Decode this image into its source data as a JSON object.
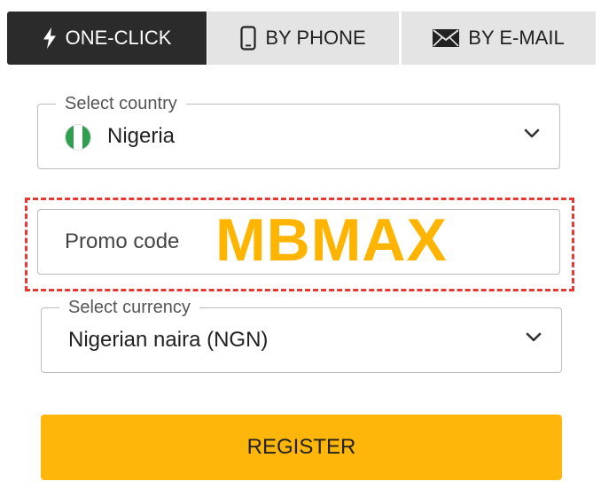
{
  "tabs": [
    {
      "label": "ONE-CLICK",
      "icon": "lightning-icon",
      "active": true
    },
    {
      "label": "BY PHONE",
      "icon": "phone-icon",
      "active": false
    },
    {
      "label": "BY E-MAIL",
      "icon": "envelope-icon",
      "active": false
    }
  ],
  "country": {
    "legend": "Select country",
    "value": "Nigeria",
    "flag_icon": "nigeria-flag-icon"
  },
  "promo": {
    "placeholder": "Promo code",
    "code": "MBMAX"
  },
  "currency": {
    "legend": "Select currency",
    "value": "Nigerian naira (NGN)"
  },
  "register": {
    "label": "REGISTER"
  },
  "colors": {
    "active_tab": "#2b2b2b",
    "inactive_tab": "#e4e4e4",
    "accent": "#ffb60a",
    "promo_code": "#ffb400",
    "highlight_frame": "#e53935"
  }
}
